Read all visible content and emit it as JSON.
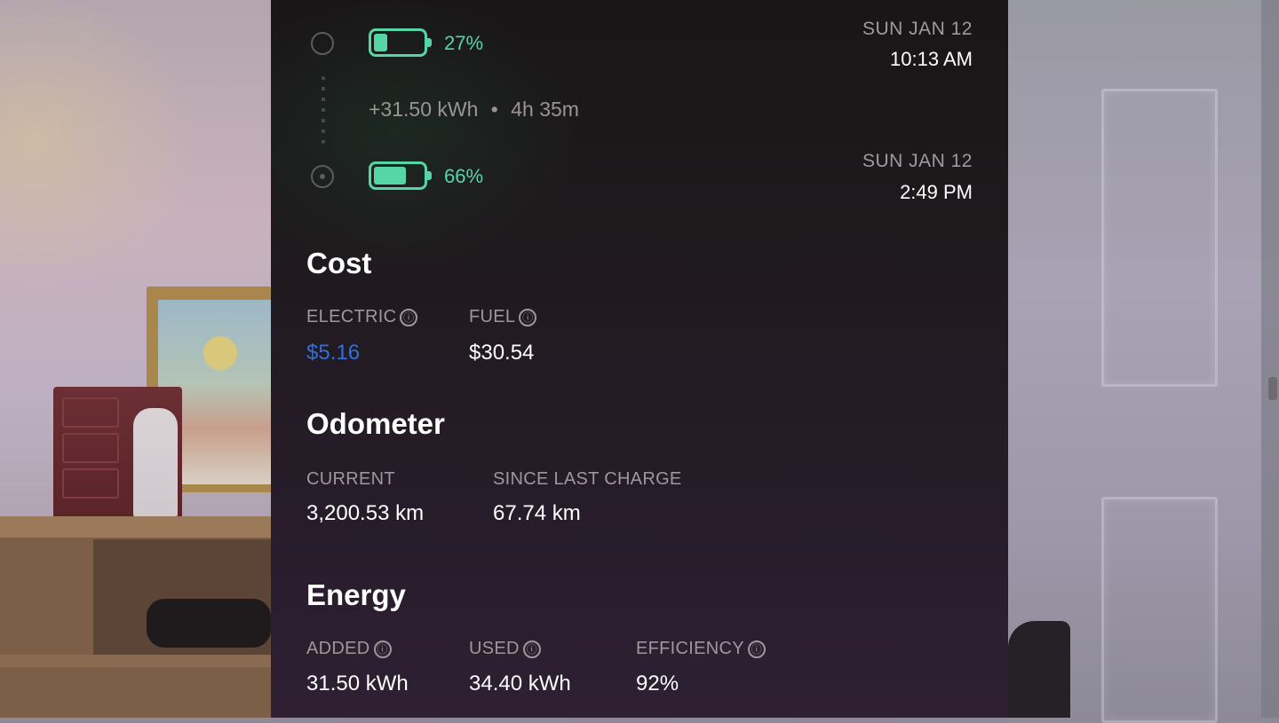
{
  "session": {
    "start": {
      "percent": "27%",
      "level": 0.27,
      "date": "SUN JAN 12",
      "time": "10:13 AM"
    },
    "delta": {
      "energy": "+31.50 kWh",
      "separator": "•",
      "duration": "4h 35m"
    },
    "end": {
      "percent": "66%",
      "level": 0.66,
      "date": "SUN JAN 12",
      "time": "2:49 PM"
    }
  },
  "cost": {
    "title": "Cost",
    "electric_label": "ELECTRIC",
    "electric_value": "$5.16",
    "fuel_label": "FUEL",
    "fuel_value": "$30.54"
  },
  "odometer": {
    "title": "Odometer",
    "current_label": "CURRENT",
    "current_value": "3,200.53 km",
    "since_label": "SINCE LAST CHARGE",
    "since_value": "67.74 km"
  },
  "energy": {
    "title": "Energy",
    "added_label": "ADDED",
    "added_value": "31.50 kWh",
    "used_label": "USED",
    "used_value": "34.40 kWh",
    "efficiency_label": "EFFICIENCY",
    "efficiency_value": "92%"
  },
  "icons": {
    "info": "ⓘ"
  },
  "colors": {
    "battery": "#56d6a8",
    "link": "#2f6fe0"
  }
}
